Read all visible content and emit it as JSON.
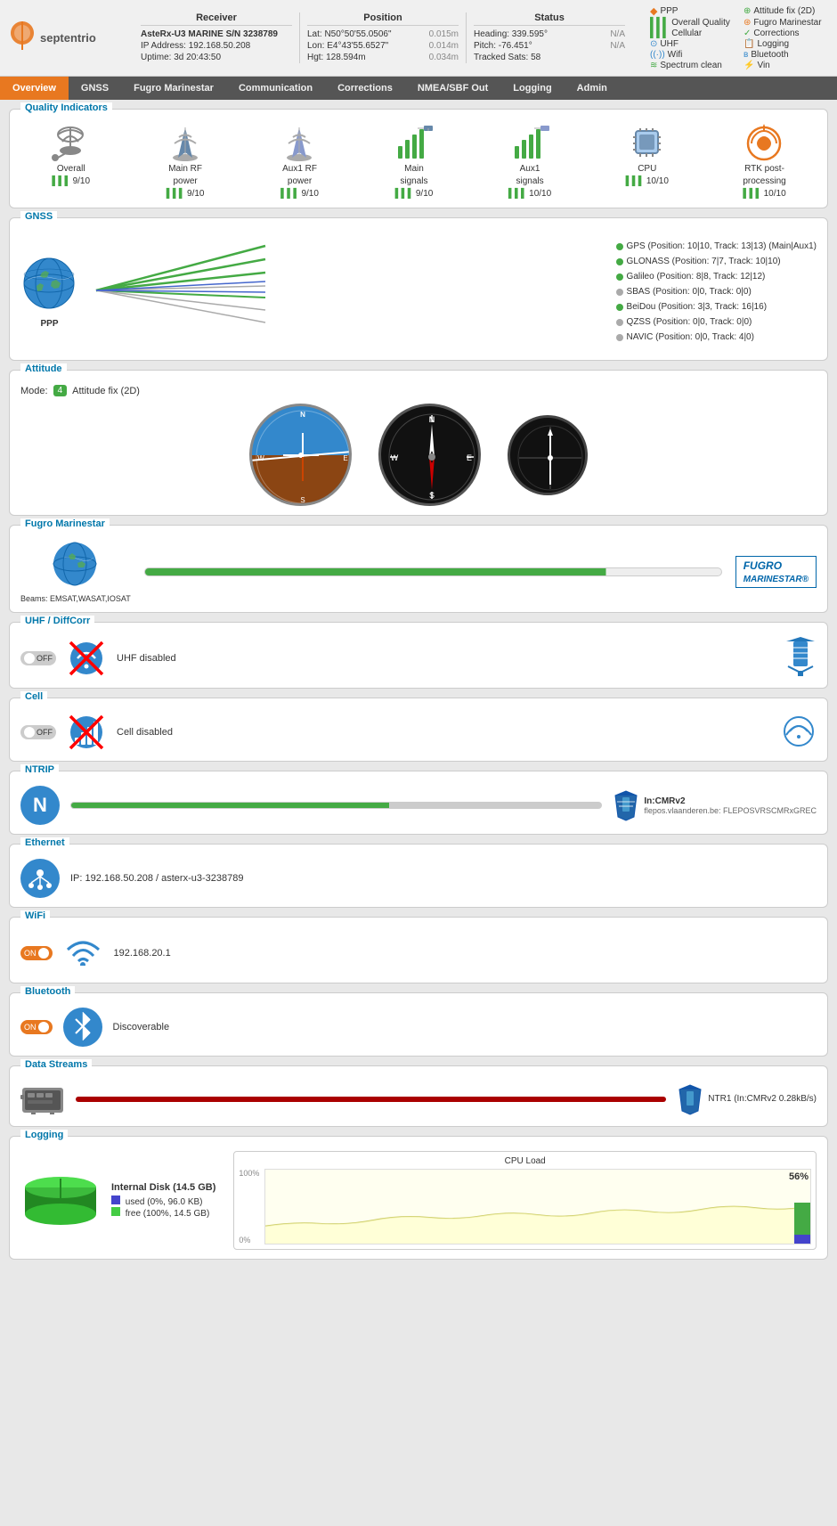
{
  "header": {
    "receiver": {
      "title": "Receiver",
      "rows": [
        {
          "label": "AsteRx-U3 MARINE S/N 3238789",
          "value": ""
        },
        {
          "label": "IP Address: 192.168.50.208",
          "value": ""
        },
        {
          "label": "Uptime: 3d 20:43:50",
          "value": ""
        }
      ]
    },
    "position": {
      "title": "Position",
      "rows": [
        {
          "label": "Lat:",
          "value": "N50°50'55.0506\"",
          "extra": "0.015m"
        },
        {
          "label": "Lon:",
          "value": "E4°43'55.6527\"",
          "extra": "0.014m"
        },
        {
          "label": "Hgt:",
          "value": "128.594m",
          "extra": "0.034m"
        }
      ]
    },
    "status": {
      "title": "Status",
      "rows": [
        {
          "label": "Heading:",
          "value": "339.595°",
          "extra": "N/A"
        },
        {
          "label": "Pitch:",
          "value": "-76.451°",
          "extra": "N/A"
        },
        {
          "label": "Tracked Sats:",
          "value": "58",
          "extra": ""
        }
      ]
    },
    "legend": [
      {
        "icon": "ppp",
        "label": "PPP",
        "color": "#e87820"
      },
      {
        "icon": "attitude",
        "label": "Attitude fix (2D)",
        "color": "#4a4"
      },
      {
        "icon": "quality",
        "label": "Overall Quality",
        "color": "#4a4"
      },
      {
        "icon": "fugro",
        "label": "Fugro Marinestar",
        "color": "#4a4"
      },
      {
        "icon": "cellular",
        "label": "Cellular",
        "color": "#4a4"
      },
      {
        "icon": "corrections",
        "label": "Corrections",
        "color": "#4a4"
      },
      {
        "icon": "uhf",
        "label": "UHF",
        "color": "#4a4"
      },
      {
        "icon": "logging",
        "label": "Logging",
        "color": "#4a4"
      },
      {
        "icon": "wifi",
        "label": "Wifi",
        "color": "#4a4"
      },
      {
        "icon": "bluetooth",
        "label": "Bluetooth",
        "color": "#4a4"
      },
      {
        "icon": "spectrum",
        "label": "Spectrum clean",
        "color": "#4a4"
      },
      {
        "icon": "vin",
        "label": "Vin",
        "color": "#4a4"
      }
    ]
  },
  "nav": {
    "items": [
      {
        "label": "Overview",
        "active": true
      },
      {
        "label": "GNSS",
        "active": false
      },
      {
        "label": "Fugro Marinestar",
        "active": false
      },
      {
        "label": "Communication",
        "active": false
      },
      {
        "label": "Corrections",
        "active": false
      },
      {
        "label": "NMEA/SBF Out",
        "active": false
      },
      {
        "label": "Logging",
        "active": false
      },
      {
        "label": "Admin",
        "active": false
      }
    ]
  },
  "quality_indicators": {
    "title": "Quality Indicators",
    "items": [
      {
        "label": "Overall",
        "score": "9/10",
        "icon": "satellite-dish"
      },
      {
        "label": "Main RF power",
        "score": "9/10",
        "icon": "rf-antenna"
      },
      {
        "label": "Aux1 RF power",
        "score": "9/10",
        "icon": "rf-antenna-aux"
      },
      {
        "label": "Main signals",
        "score": "9/10",
        "icon": "signal-main"
      },
      {
        "label": "Aux1 signals",
        "score": "10/10",
        "icon": "signal-aux"
      },
      {
        "label": "CPU",
        "score": "10/10",
        "icon": "cpu-chip"
      },
      {
        "label": "RTK post-processing",
        "score": "10/10",
        "icon": "rtk-icon"
      }
    ]
  },
  "gnss": {
    "title": "GNSS",
    "systems": [
      {
        "name": "GPS",
        "detail": "(Position: 10|10, Track: 13|13) (Main|Aux1)",
        "color": "#44aa44"
      },
      {
        "name": "GLONASS",
        "detail": "(Position: 7|7, Track: 10|10)",
        "color": "#44aa44"
      },
      {
        "name": "Galileo",
        "detail": "(Position: 8|8, Track: 12|12)",
        "color": "#44aa44"
      },
      {
        "name": "SBAS",
        "detail": "(Position: 0|0, Track: 0|0)",
        "color": "#aaaaaa"
      },
      {
        "name": "BeiDou",
        "detail": "(Position: 3|3, Track: 16|16)",
        "color": "#44aa44"
      },
      {
        "name": "QZSS",
        "detail": "(Position: 0|0, Track: 0|0)",
        "color": "#aaaaaa"
      },
      {
        "name": "NAVIC",
        "detail": "(Position: 0|0, Track: 4|0)",
        "color": "#aaaaaa"
      }
    ]
  },
  "attitude": {
    "title": "Attitude",
    "mode_label": "Mode:",
    "mode_badge": "4",
    "mode_text": "Attitude fix (2D)"
  },
  "fugro_marinestar": {
    "title": "Fugro Marinestar",
    "beams": "Beams: EMSAT,WASAT,IOSAT",
    "logo_text": "MARINESTAR®"
  },
  "uhf": {
    "title": "UHF / DiffCorr",
    "state": "OFF",
    "status_text": "UHF disabled"
  },
  "cell": {
    "title": "Cell",
    "state": "OFF",
    "status_text": "Cell disabled"
  },
  "ntrip": {
    "title": "NTRIP",
    "icon_letter": "N",
    "connection_label": "In:CMRv2",
    "server": "flepos.vlaanderen.be: FLEPOSVRSCMRxGREC"
  },
  "ethernet": {
    "title": "Ethernet",
    "ip_info": "IP: 192.168.50.208 / asterx-u3-3238789"
  },
  "wifi": {
    "title": "WiFi",
    "state": "ON",
    "ip": "192.168.20.1"
  },
  "bluetooth": {
    "title": "Bluetooth",
    "state": "ON",
    "status_text": "Discoverable"
  },
  "data_streams": {
    "title": "Data Streams",
    "stream_label": "NTR1 (In:CMRv2 0.28kB/s)"
  },
  "logging": {
    "title": "Logging",
    "disk_title": "Internal Disk (14.5 GB)",
    "used_label": "used (0%, 96.0 KB)",
    "free_label": "free (100%, 14.5 GB)",
    "cpu_title": "CPU Load",
    "cpu_100": "100%",
    "cpu_0": "0%",
    "cpu_percent": "56%"
  }
}
